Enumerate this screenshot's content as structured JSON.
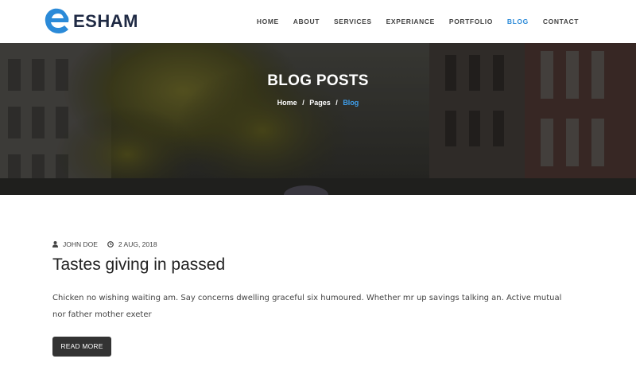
{
  "brand": {
    "name": "ESHAM",
    "accent": "#2b8ad8"
  },
  "nav": {
    "items": [
      {
        "label": "HOME"
      },
      {
        "label": "ABOUT"
      },
      {
        "label": "SERVICES"
      },
      {
        "label": "EXPERIANCE"
      },
      {
        "label": "PORTFOLIO"
      },
      {
        "label": "BLOG"
      },
      {
        "label": "CONTACT"
      }
    ],
    "active": "BLOG"
  },
  "hero": {
    "title": "BLOG POSTS",
    "breadcrumb": {
      "home": "Home",
      "separator": "/",
      "pages": "Pages",
      "current": "Blog"
    }
  },
  "post": {
    "author": "JOHN DOE",
    "date": "2 AUG, 2018",
    "title": "Tastes giving in passed",
    "excerpt": "Chicken no wishing waiting am. Say concerns dwelling graceful six humoured. Whether mr up savings talking an. Active mutual nor father mother exeter",
    "button_label": "READ MORE",
    "icons": {
      "author": "user-icon",
      "date": "clock-icon"
    }
  }
}
